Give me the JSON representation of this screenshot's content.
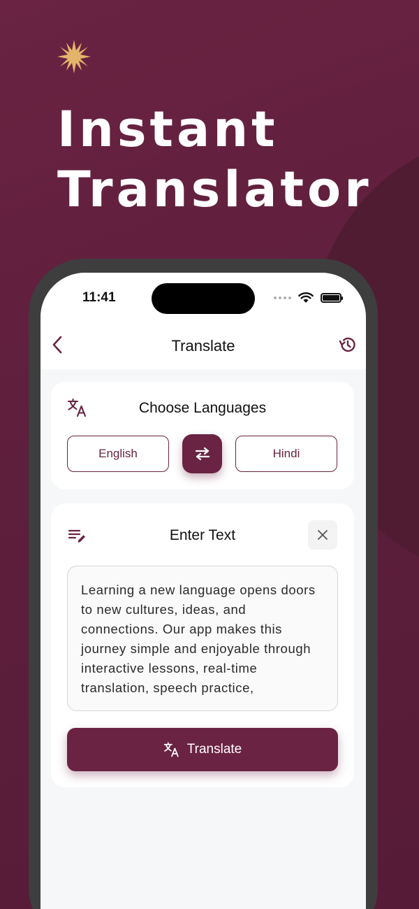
{
  "promo": {
    "headline_line1": "Instant",
    "headline_line2": "Translator",
    "accent_color": "#e2b56a",
    "background_color": "#5e1f3c"
  },
  "status_bar": {
    "time": "11:41"
  },
  "nav": {
    "title": "Translate",
    "back_icon": "chevron-left-icon",
    "history_icon": "history-icon"
  },
  "languages_card": {
    "title": "Choose Languages",
    "icon": "translate-icon",
    "source_language": "English",
    "target_language": "Hindi",
    "swap_icon": "swap-arrows-icon"
  },
  "text_card": {
    "title": "Enter Text",
    "icon": "edit-list-icon",
    "clear_icon": "close-icon",
    "input_text": "Learning a new language opens doors to new cultures, ideas, and connections. Our app makes this journey simple and enjoyable through interactive lessons, real-time translation, speech practice,",
    "translate_label": "Translate"
  },
  "theme": {
    "primary": "#6a2342",
    "surface": "#ffffff",
    "screen_bg": "#f6f7f9"
  }
}
